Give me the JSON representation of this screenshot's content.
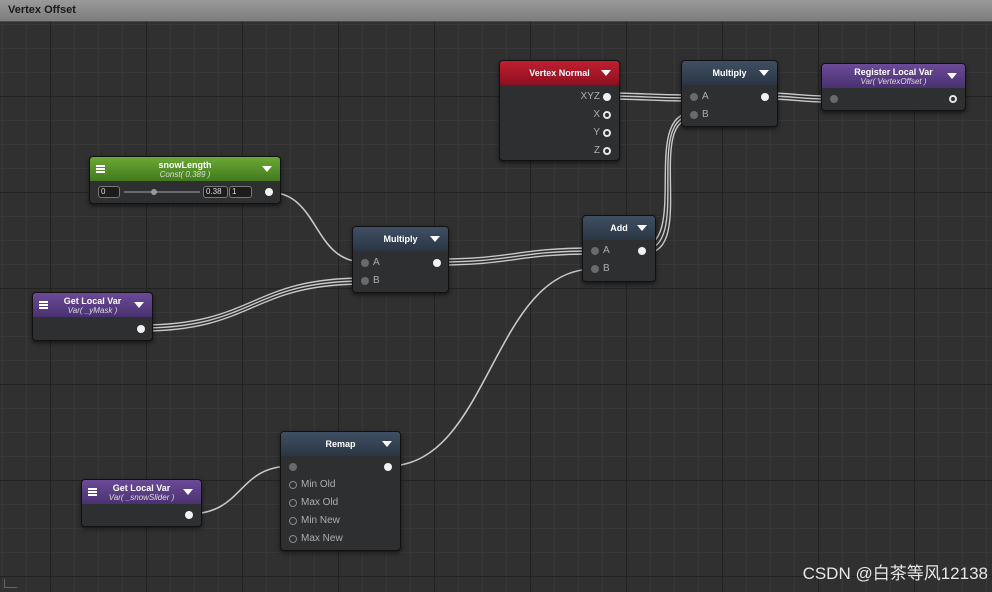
{
  "window": {
    "title": "Vertex Offset"
  },
  "nodes": {
    "vertex_normal": {
      "title": "Vertex Normal",
      "outputs": [
        "XYZ",
        "X",
        "Y",
        "Z"
      ]
    },
    "multiply_top": {
      "title": "Multiply",
      "inputs": [
        "A",
        "B"
      ]
    },
    "register_var": {
      "title": "Register Local Var",
      "subtitle": "Var( VertexOffset )"
    },
    "snow_length": {
      "title": "snowLength",
      "subtitle": "Const( 0.389 )",
      "min": "0",
      "value": "0.38",
      "max": "1",
      "slider_fraction": 0.389
    },
    "multiply_mid": {
      "title": "Multiply",
      "inputs": [
        "A",
        "B"
      ]
    },
    "add": {
      "title": "Add",
      "inputs": [
        "A",
        "B"
      ]
    },
    "get_ymask": {
      "title": "Get Local Var",
      "subtitle": "Var( _yMask )"
    },
    "remap": {
      "title": "Remap",
      "inputs": [
        "Min Old",
        "Max Old",
        "Min New",
        "Max New"
      ]
    },
    "get_snowslider": {
      "title": "Get Local Var",
      "subtitle": "Var( _snowSlider )"
    }
  },
  "colors": {
    "header_blue": "#36465a",
    "header_red": "#b01a2b",
    "header_green": "#5c9a2e",
    "header_purple": "#5e4088",
    "wire": "#c8c8c8"
  },
  "watermark": "CSDN @白茶等风12138"
}
